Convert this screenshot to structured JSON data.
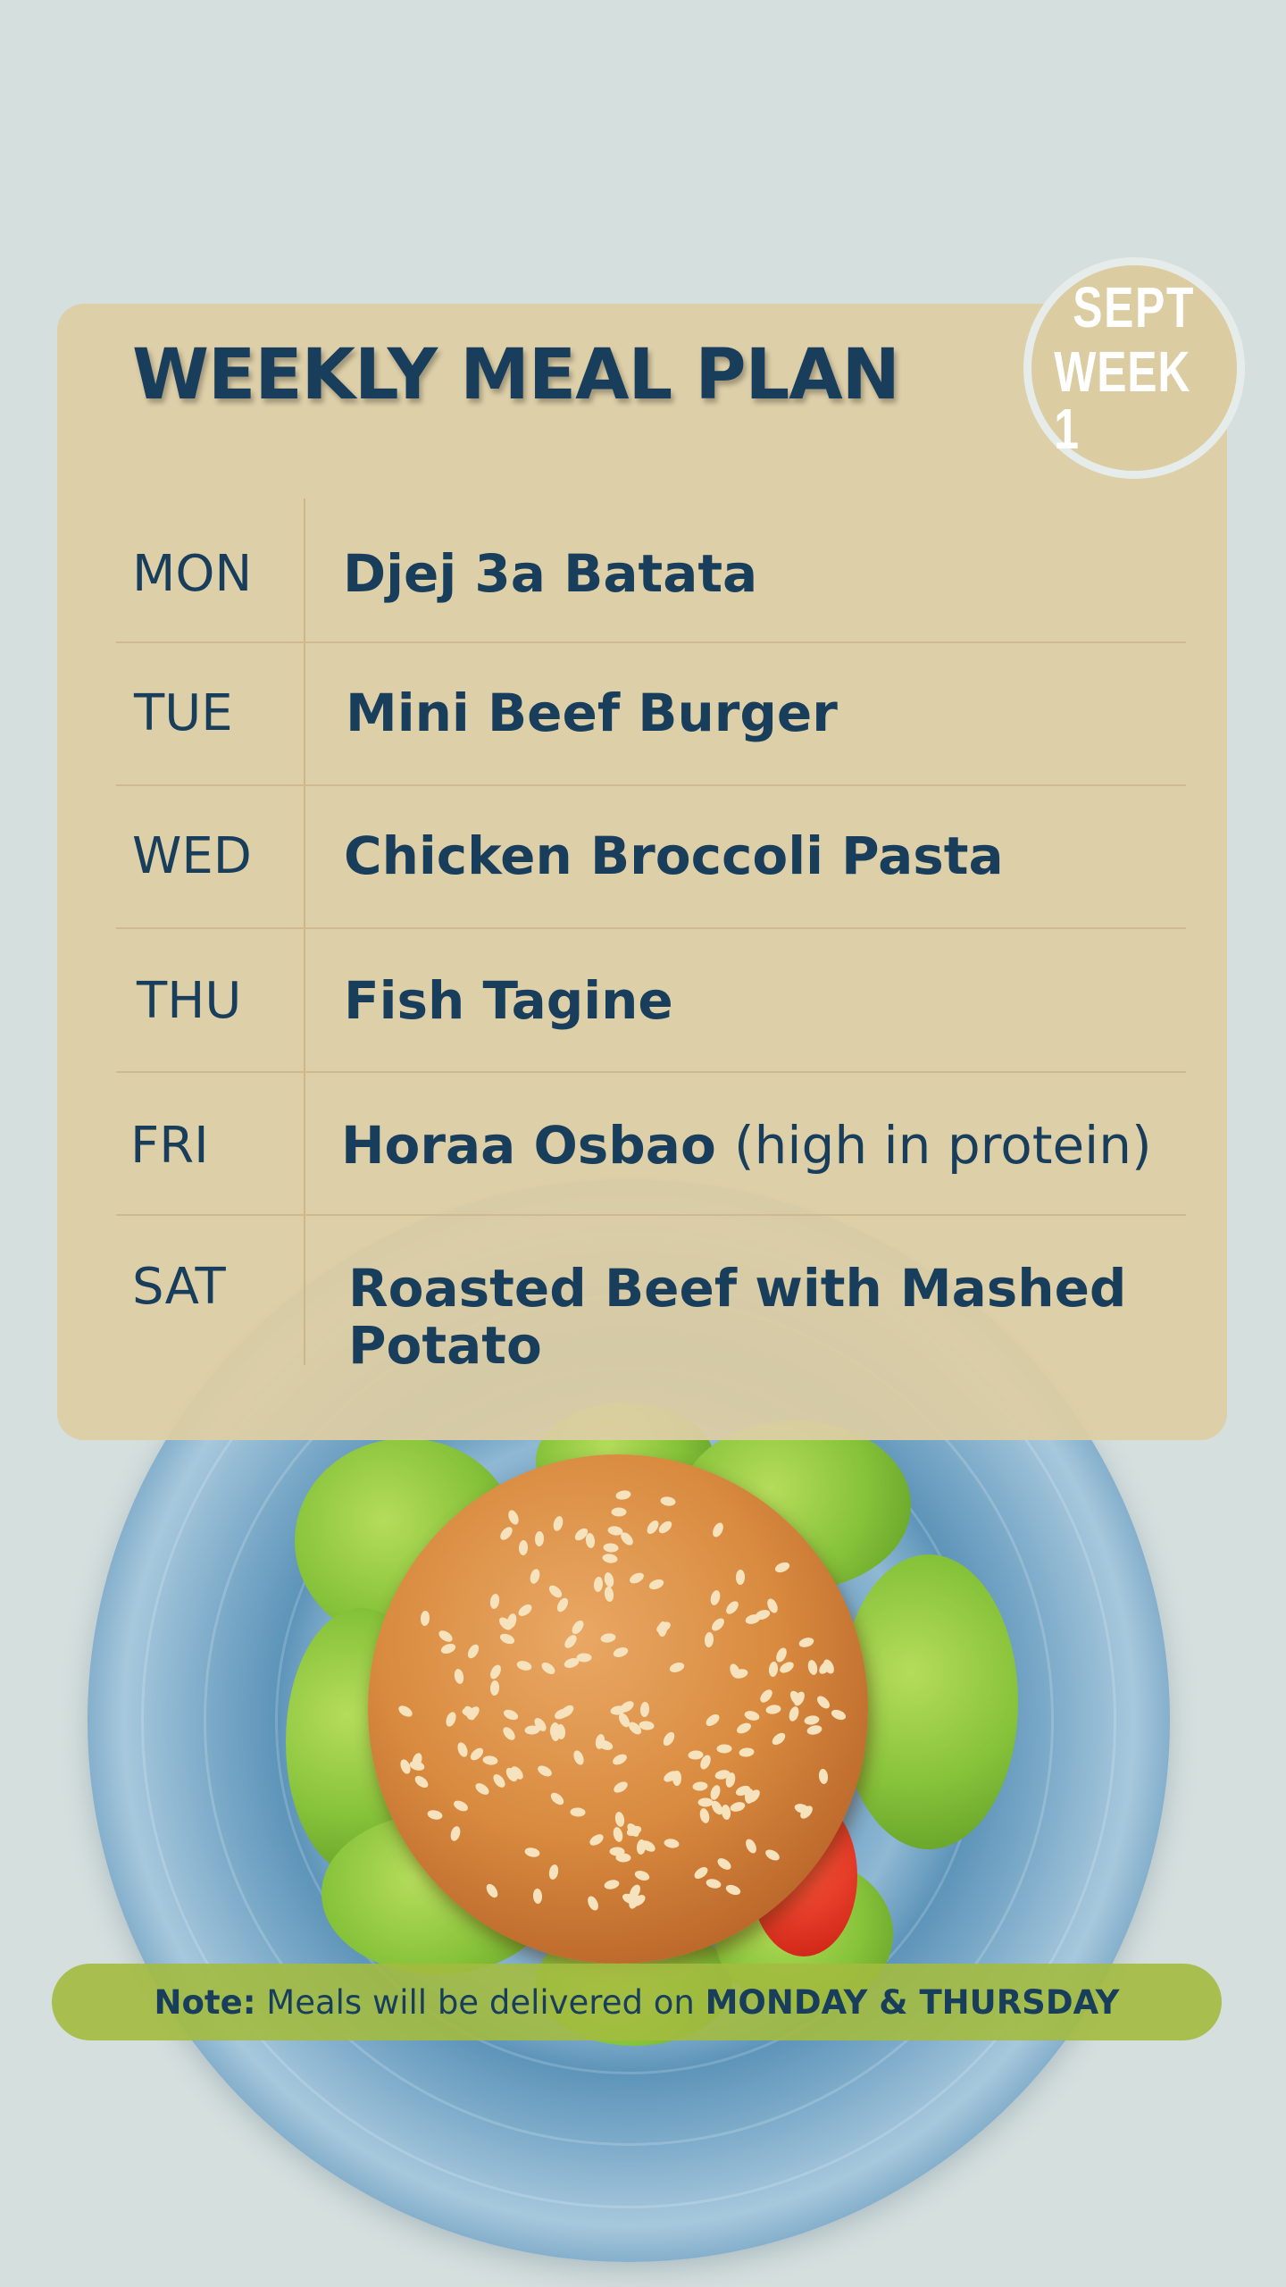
{
  "poster": {
    "title": "WEEKLY MEAL PLAN",
    "badge": {
      "line1": "SEPT",
      "line2": "WEEK 1"
    }
  },
  "plan": [
    {
      "day": "MON",
      "meal": "Djej 3a Batata",
      "extra": ""
    },
    {
      "day": "TUE",
      "meal": "Mini Beef Burger",
      "extra": ""
    },
    {
      "day": "WED",
      "meal": "Chicken Broccoli Pasta",
      "extra": ""
    },
    {
      "day": "THU",
      "meal": "Fish Tagine",
      "extra": ""
    },
    {
      "day": "FRI",
      "meal": "Horaa Osbao",
      "extra": "(high in protein)"
    },
    {
      "day": "SAT",
      "meal": "Roasted Beef with Mashed",
      "meal_line2": "Potato",
      "extra": ""
    }
  ],
  "note": {
    "label": "Note:",
    "text": "Meals will be delivered on",
    "emphasis": "MONDAY & THURSDAY"
  },
  "colors": {
    "background": "#d5dfde",
    "card": "#dececa4",
    "text": "#183e5c",
    "note_bar": "#a3bb40",
    "badge": "#dbcca1"
  },
  "image": {
    "subject": "burger-on-blue-plate"
  }
}
